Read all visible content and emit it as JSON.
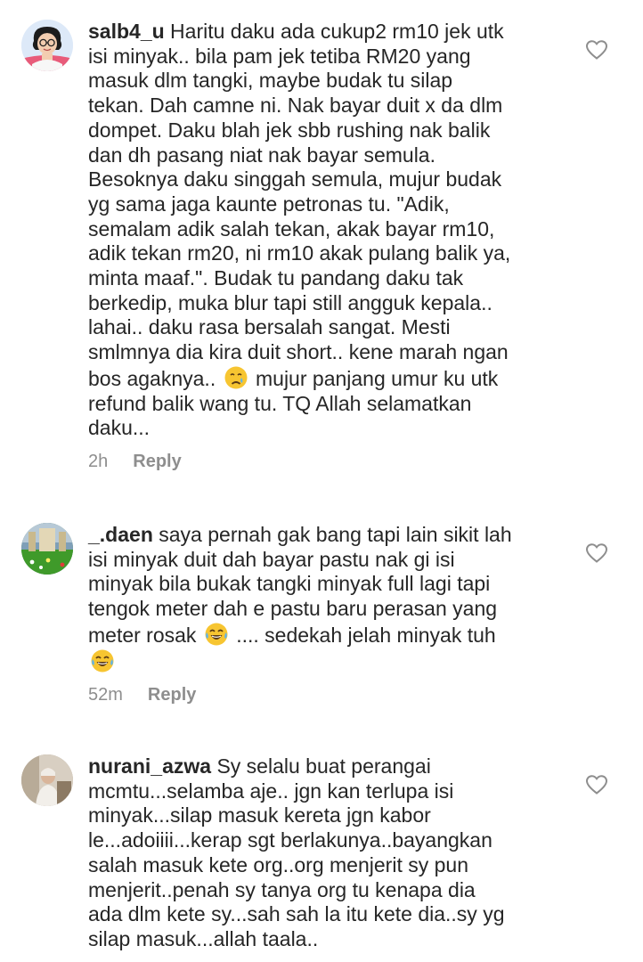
{
  "comments": [
    {
      "username": "salb4_u",
      "text_before_emoji": "Haritu daku ada cukup2 rm10 jek utk\nisi minyak.. bila pam jek tetiba RM20 yang\nmasuk dlm tangki, maybe budak tu silap\ntekan. Dah camne ni. Nak bayar duit x da dlm\ndompet. Daku blah jek sbb rushing nak balik\ndan dh pasang niat nak bayar semula.\nBesoknya daku singgah semula, mujur budak\nyg sama jaga kaunte petronas tu. \"Adik,\nsemalam adik salah tekan, akak bayar rm10,\nadik tekan rm20, ni rm10 akak pulang balik ya,\nminta maaf.\". Budak tu pandang daku tak\nberkedip, muka blur tapi still angguk kepala..\nlahai.. daku rasa bersalah sangat. Mesti\nsmlmnya dia kira duit short.. kene marah ngan\nbos agaknya..",
      "emoji_1": "crying-face-emoji",
      "text_after_emoji": "mujur panjang umur ku utk\nrefund balik wang tu. TQ Allah selamatkan\ndaku...",
      "time": "2h",
      "reply_label": "Reply",
      "avatar": "cartoon-girl-avatar"
    },
    {
      "username": "_.daen",
      "text_before_emoji": "saya pernah gak bang tapi lain sikit lah\nisi minyak duit dah bayar pastu nak gi isi\nminyak bila bukak tangki minyak full lagi tapi\ntengok meter dah e pastu baru perasan yang\nmeter rosak",
      "emoji_1": "tears-of-joy-emoji",
      "text_after_emoji": ".... sedekah jelah minyak tuh",
      "emoji_2": "tears-of-joy-emoji",
      "time": "52m",
      "reply_label": "Reply",
      "avatar": "photo-avatar"
    },
    {
      "username": "nurani_azwa",
      "text_before_emoji": "Sy selalu buat perangai\nmcmtu...selamba aje.. jgn kan terlupa isi\nminyak...silap masuk kereta jgn kabor\nle...adoiiii...kerap sgt berlakunya..bayangkan\nsalah masuk kete org..org menjerit sy pun\nmenjerit..penah sy tanya org tu kenapa dia\nada dlm kete sy...sah sah la itu kete dia..sy yg\nsilap masuk...allah taala..",
      "avatar": "photo-avatar"
    }
  ],
  "colors": {
    "text": "#262626",
    "meta": "#8e8e8e",
    "heart_stroke": "#8e8e8e"
  }
}
